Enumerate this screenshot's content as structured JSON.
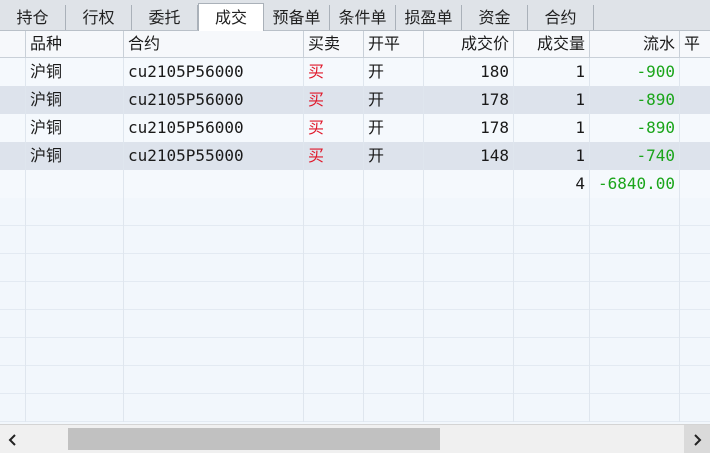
{
  "tabs": [
    {
      "label": "持仓"
    },
    {
      "label": "行权"
    },
    {
      "label": "委托"
    },
    {
      "label": "成交",
      "active": true
    },
    {
      "label": "预备单"
    },
    {
      "label": "条件单"
    },
    {
      "label": "损盈单"
    },
    {
      "label": "资金"
    },
    {
      "label": "合约"
    }
  ],
  "table": {
    "columns": [
      "品种",
      "合约",
      "买卖",
      "开平",
      "成交价",
      "成交量",
      "流水",
      "平"
    ],
    "rows": [
      {
        "variety": "沪铜",
        "contract": "cu2105P56000",
        "side": "买",
        "open_close": "开",
        "price": "180",
        "volume": "1",
        "flow": "-900"
      },
      {
        "variety": "沪铜",
        "contract": "cu2105P56000",
        "side": "买",
        "open_close": "开",
        "price": "178",
        "volume": "1",
        "flow": "-890"
      },
      {
        "variety": "沪铜",
        "contract": "cu2105P56000",
        "side": "买",
        "open_close": "开",
        "price": "178",
        "volume": "1",
        "flow": "-890"
      },
      {
        "variety": "沪铜",
        "contract": "cu2105P55000",
        "side": "买",
        "open_close": "开",
        "price": "148",
        "volume": "1",
        "flow": "-740"
      }
    ],
    "total": {
      "volume": "4",
      "flow": "-6840.00"
    }
  },
  "colors": {
    "buy": "#e0192b",
    "flow_negative": "#1aa51a",
    "row_stripe": "#dde3ec"
  },
  "scrollbar": {
    "left_icon": "chevron-left-icon",
    "right_icon": "chevron-right-icon"
  }
}
